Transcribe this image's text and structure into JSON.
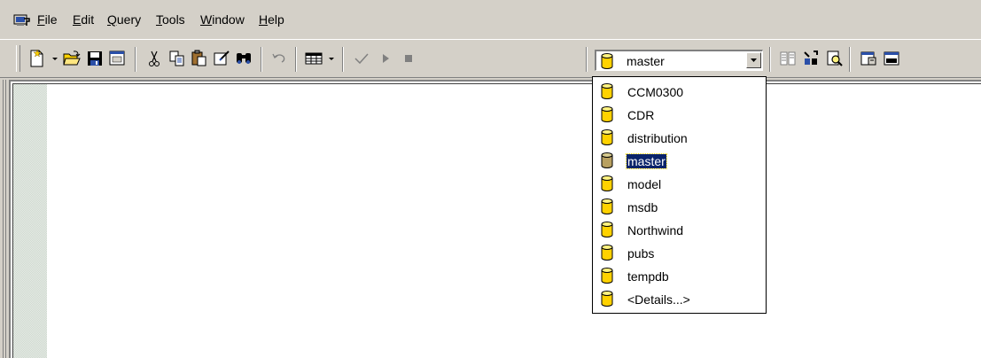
{
  "menu": {
    "items": [
      {
        "label": "File"
      },
      {
        "label": "Edit"
      },
      {
        "label": "Query"
      },
      {
        "label": "Tools"
      },
      {
        "label": "Window"
      },
      {
        "label": "Help"
      }
    ]
  },
  "toolbar": {
    "icons": [
      "new-query-icon",
      "open-icon",
      "save-icon",
      "load-script-icon",
      "cut-icon",
      "copy-icon",
      "paste-icon",
      "clear-window-icon",
      "find-icon",
      "undo-icon",
      "results-grid-icon",
      "parse-check-icon",
      "execute-icon",
      "cancel-icon",
      "object-browser-icon",
      "object-search-icon",
      "execution-plan-icon",
      "properties-icon",
      "show-results-icon"
    ],
    "database_combo": {
      "value": "master"
    }
  },
  "database_list": {
    "items": [
      "CCM0300",
      "CDR",
      "distribution",
      "master",
      "model",
      "msdb",
      "Northwind",
      "pubs",
      "tempdb",
      "<Details...>"
    ],
    "selected": "master"
  },
  "colors": {
    "chrome": "#d4d0c8",
    "selection": "#0a246a",
    "db_icon": "#ffd200"
  }
}
